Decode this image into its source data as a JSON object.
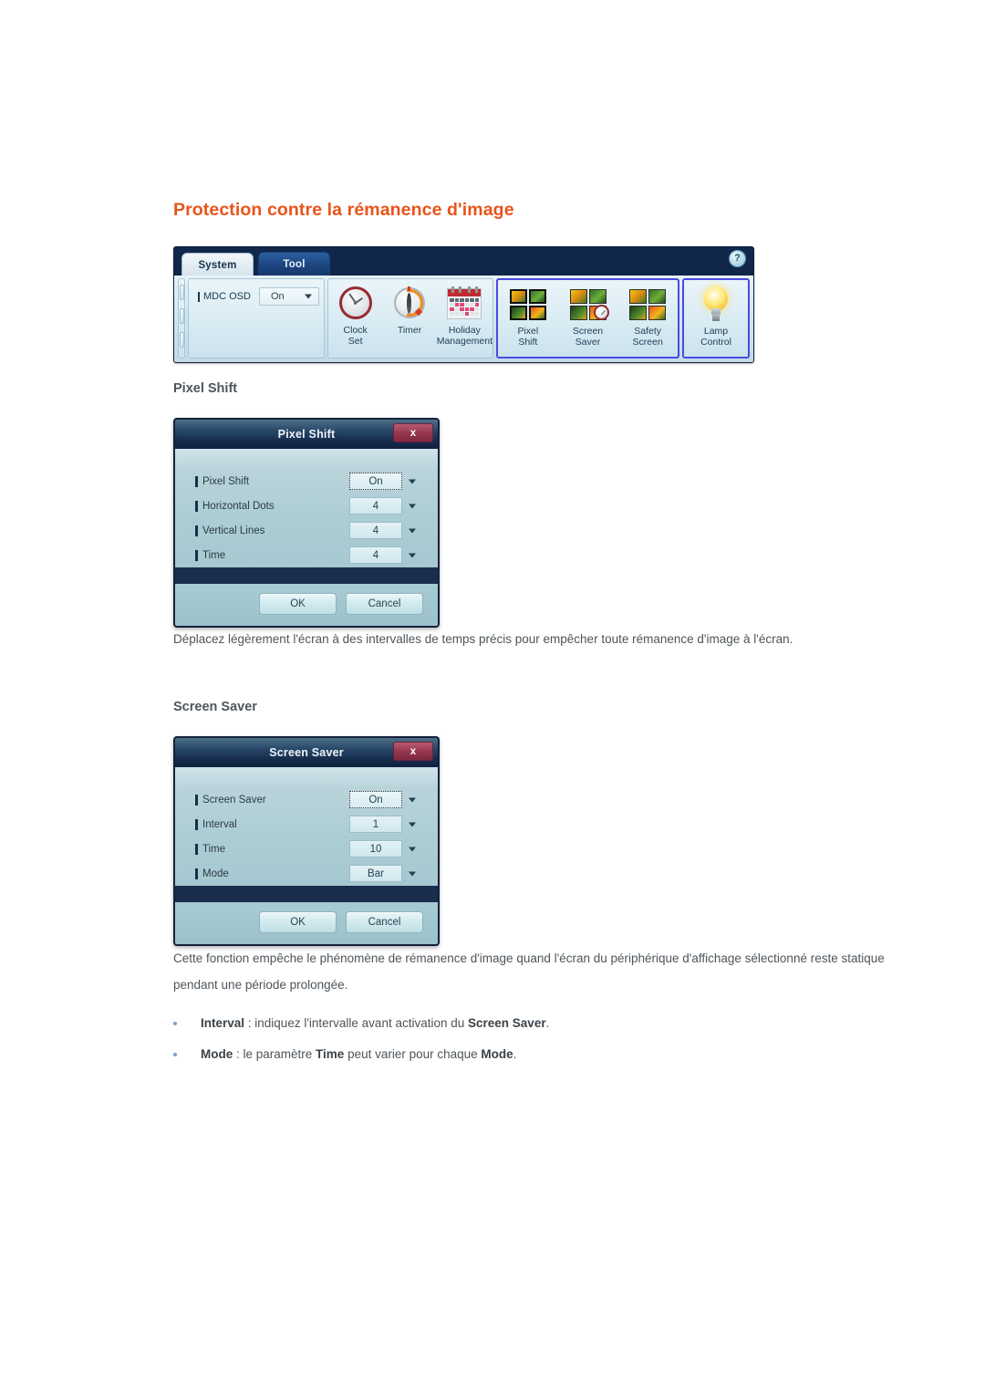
{
  "page": {
    "title": "Protection contre la rémanence d'image"
  },
  "ribbon": {
    "tabs": [
      {
        "label": "System",
        "active": true
      },
      {
        "label": "Tool",
        "active": false
      }
    ],
    "help_label": "?",
    "osd": {
      "label": "MDC OSD",
      "value": "On"
    },
    "groups": [
      {
        "name": "clock-group",
        "items": [
          {
            "label": "Clock\nSet",
            "icon": "clock-icon"
          },
          {
            "label": "Timer",
            "icon": "timer-icon"
          },
          {
            "label": "Holiday\nManagement",
            "icon": "calendar-icon"
          }
        ]
      },
      {
        "name": "protection-group",
        "highlighted": true,
        "items": [
          {
            "label": "Pixel\nShift",
            "icon": "pixel-shift-icon"
          },
          {
            "label": "Screen\nSaver",
            "icon": "screen-saver-icon"
          },
          {
            "label": "Safety\nScreen",
            "icon": "safety-screen-icon"
          }
        ]
      },
      {
        "name": "lamp-group",
        "highlighted": true,
        "items": [
          {
            "label": "Lamp\nControl",
            "icon": "lamp-icon"
          }
        ]
      }
    ]
  },
  "sections": [
    {
      "heading": "Pixel Shift",
      "dialog": {
        "title": "Pixel Shift",
        "close_label": "x",
        "rows": [
          {
            "label": "Pixel Shift",
            "value": "On",
            "focused": true
          },
          {
            "label": "Horizontal Dots",
            "value": "4",
            "focused": false
          },
          {
            "label": "Vertical Lines",
            "value": "4",
            "focused": false
          },
          {
            "label": "Time",
            "value": "4",
            "focused": false
          }
        ],
        "ok_label": "OK",
        "cancel_label": "Cancel"
      },
      "paragraph": "Déplacez légèrement l'écran à des intervalles de temps précis pour empêcher toute rémanence d'image à l'écran."
    },
    {
      "heading": "Screen Saver",
      "dialog": {
        "title": "Screen Saver",
        "close_label": "x",
        "rows": [
          {
            "label": "Screen Saver",
            "value": "On",
            "focused": true
          },
          {
            "label": "Interval",
            "value": "1",
            "focused": false
          },
          {
            "label": "Time",
            "value": "10",
            "focused": false
          },
          {
            "label": "Mode",
            "value": "Bar",
            "focused": false
          }
        ],
        "ok_label": "OK",
        "cancel_label": "Cancel"
      },
      "paragraph": "Cette fonction empêche le phénomène de rémanence d'image quand l'écran du périphérique d'affichage sélectionné reste statique pendant une période prolongée."
    }
  ],
  "bullets": [
    {
      "parts": [
        {
          "text": "Interval",
          "bold": true
        },
        {
          "text": " : indiquez l'intervalle avant activation du ",
          "bold": false
        },
        {
          "text": "Screen Saver",
          "bold": true
        },
        {
          "text": ".",
          "bold": false
        }
      ]
    },
    {
      "parts": [
        {
          "text": "Mode",
          "bold": true
        },
        {
          "text": " : le paramètre ",
          "bold": false
        },
        {
          "text": "Time",
          "bold": true
        },
        {
          "text": " peut varier pour chaque ",
          "bold": false
        },
        {
          "text": "Mode",
          "bold": true
        },
        {
          "text": ".",
          "bold": false
        }
      ]
    }
  ],
  "colors": {
    "heading": "#e8541b",
    "section_heading": "#4b565e",
    "body_text": "#4d555b",
    "highlight_border": "#4a4ae0"
  }
}
